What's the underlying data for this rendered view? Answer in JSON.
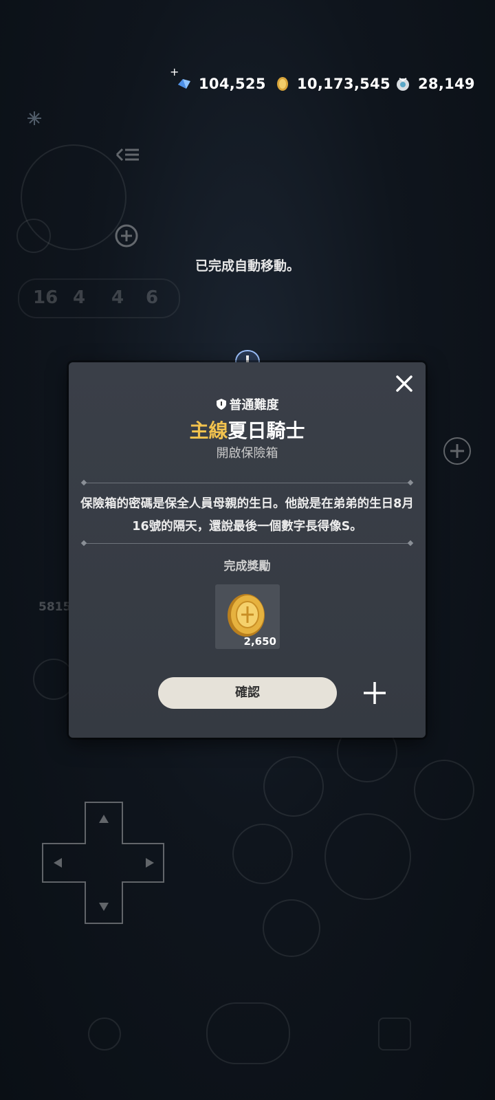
{
  "currencies": [
    {
      "icon": "crystal-icon",
      "value": "104,525"
    },
    {
      "icon": "gold-coin-icon",
      "value": "10,173,545"
    },
    {
      "icon": "gem-pouch-icon",
      "value": "28,149"
    }
  ],
  "top_plus": "+",
  "toast": "已完成自動移動。",
  "hud": {
    "stats": [
      "16",
      "4",
      "4",
      "6"
    ],
    "food_value": "5815"
  },
  "modal": {
    "difficulty": "普通難度",
    "title_prefix": "主線",
    "title_main": "夏日騎士",
    "subtitle": "開啟保險箱",
    "description": "保險箱的密碼是保全人員母親的生日。他說是在弟弟的生日8月16號的隔天，還說最後一個數字長得像S。",
    "reward_label": "完成獎勵",
    "reward_qty": "2,650",
    "confirm_label": "確認"
  },
  "colors": {
    "title_accent": "#f2c24e",
    "confirm_bg": "#e6e2d9"
  }
}
